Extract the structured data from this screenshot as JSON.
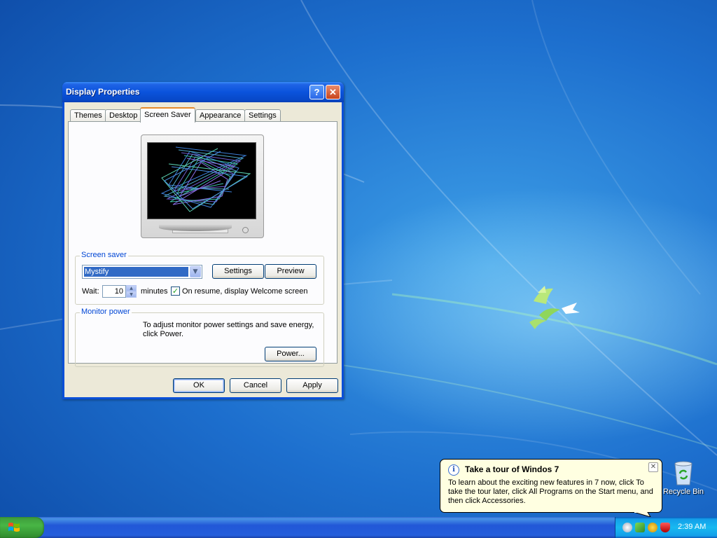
{
  "window": {
    "title": "Display Properties",
    "help_label": "?",
    "close_label": "✕"
  },
  "tabs": [
    {
      "label": "Themes"
    },
    {
      "label": "Desktop"
    },
    {
      "label": "Screen Saver",
      "active": true
    },
    {
      "label": "Appearance"
    },
    {
      "label": "Settings"
    }
  ],
  "screen_saver": {
    "group_label": "Screen saver",
    "selected": "Mystify",
    "settings_label": "Settings",
    "preview_label": "Preview",
    "wait_label": "Wait:",
    "wait_value": "10",
    "minutes_label": "minutes",
    "resume_checked": true,
    "resume_label": "On resume, display Welcome screen"
  },
  "monitor_power": {
    "group_label": "Monitor power",
    "description": "To adjust monitor power settings and save energy, click Power.",
    "power_label": "Power..."
  },
  "buttons": {
    "ok": "OK",
    "cancel": "Cancel",
    "apply": "Apply"
  },
  "balloon": {
    "title": "Take a tour of Windos 7",
    "body": "To learn about the exciting new features in 7 now, click To take the tour later, click All Programs on the Start menu, and then click Accessories.",
    "close_label": "✕"
  },
  "desktop_icons": [
    {
      "label": "Recycle Bin",
      "icon": "recycle-bin-icon"
    }
  ],
  "taskbar": {
    "clock": "2:39 AM",
    "tray_icons": [
      "volume-icon",
      "network-icon",
      "update-icon",
      "security-shield-icon"
    ]
  },
  "colors": {
    "accent": "#0a53dc",
    "selection": "#316ac5",
    "group_label": "#0046d5",
    "tab_highlight": "#e68b2c"
  }
}
